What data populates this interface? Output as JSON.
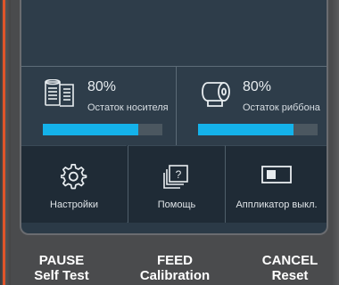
{
  "status": {
    "media": {
      "percent_text": "80%",
      "label": "Остаток носителя",
      "fill": 0.8,
      "icon": "media-roll-icon"
    },
    "ribbon": {
      "percent_text": "80%",
      "label": "Остаток риббона",
      "fill": 0.8,
      "icon": "ribbon-roll-icon"
    }
  },
  "menu": {
    "settings_label": "Настройки",
    "help_label": "Помощь",
    "applicator_label": "Аппликатор выкл."
  },
  "hardware": {
    "pause": {
      "line1": "PAUSE",
      "line2": "Self Test"
    },
    "feed": {
      "line1": "FEED",
      "line2": "Calibration"
    },
    "cancel": {
      "line1": "CANCEL",
      "line2": "Reset"
    }
  },
  "colors": {
    "accent": "#14b2ea",
    "bar_track": "#4b5760",
    "screen_bg": "#2e3d4a",
    "button_bg": "#1f2b36",
    "bezel_accent": "#e0552a"
  }
}
